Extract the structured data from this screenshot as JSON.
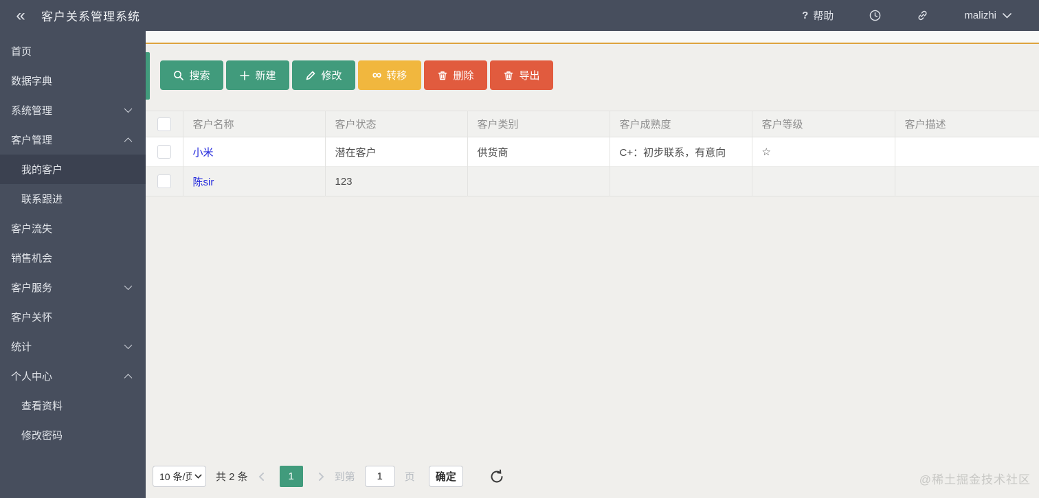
{
  "header": {
    "collapse_icon": "«",
    "title": "客户关系管理系统",
    "help_mark": "?",
    "help_label": "帮助",
    "username": "malizhi"
  },
  "sidebar": {
    "items": [
      {
        "label": "首页",
        "type": "top",
        "chevron": "none",
        "active": false
      },
      {
        "label": "数据字典",
        "type": "top",
        "chevron": "none",
        "active": false
      },
      {
        "label": "系统管理",
        "type": "top",
        "chevron": "down",
        "active": false
      },
      {
        "label": "客户管理",
        "type": "top",
        "chevron": "up",
        "active": false
      },
      {
        "label": "我的客户",
        "type": "sub",
        "chevron": "none",
        "active": true
      },
      {
        "label": "联系跟进",
        "type": "sub",
        "chevron": "none",
        "active": false
      },
      {
        "label": "客户流失",
        "type": "top",
        "chevron": "none",
        "active": false
      },
      {
        "label": "销售机会",
        "type": "top",
        "chevron": "none",
        "active": false
      },
      {
        "label": "客户服务",
        "type": "top",
        "chevron": "down",
        "active": false
      },
      {
        "label": "客户关怀",
        "type": "top",
        "chevron": "none",
        "active": false
      },
      {
        "label": "统计",
        "type": "top",
        "chevron": "down",
        "active": false
      },
      {
        "label": "个人中心",
        "type": "top",
        "chevron": "up",
        "active": false
      },
      {
        "label": "查看资料",
        "type": "sub",
        "chevron": "none",
        "active": false
      },
      {
        "label": "修改密码",
        "type": "sub",
        "chevron": "none",
        "active": false
      }
    ]
  },
  "toolbar": {
    "buttons": [
      {
        "label": "搜索",
        "icon": "search-icon",
        "color": "#419b7c"
      },
      {
        "label": "新建",
        "icon": "plus-icon",
        "color": "#419b7c"
      },
      {
        "label": "修改",
        "icon": "pencil-icon",
        "color": "#419b7c"
      },
      {
        "label": "转移",
        "icon": "transfer-icon",
        "color": "#f1b73e",
        "glyph": "∞"
      },
      {
        "label": "删除",
        "icon": "trash-icon",
        "color": "#e15b3e"
      },
      {
        "label": "导出",
        "icon": "trash-icon",
        "color": "#e15b3e"
      }
    ]
  },
  "table": {
    "columns": [
      "客户名称",
      "客户状态",
      "客户类别",
      "客户成熟度",
      "客户等级",
      "客户描述"
    ],
    "rows": [
      {
        "name": "小米",
        "status": "潜在客户",
        "category": "供货商",
        "maturity": "C+：初步联系，有意向",
        "level": "☆",
        "description": ""
      },
      {
        "name": "陈sir",
        "status": "123",
        "category": "",
        "maturity": "",
        "level": "",
        "description": ""
      }
    ]
  },
  "pagination": {
    "page_size": "10 条/页",
    "total": "共 2 条",
    "current_page": "1",
    "goto_prefix": "到第",
    "goto_value": "1",
    "goto_suffix": "页",
    "confirm_label": "确定"
  },
  "watermark": "@稀土掘金技术社区",
  "colors": {
    "header_dark": "#474e5d",
    "sidebar_active": "#3b4150",
    "accent_teal": "#419b7c",
    "accent_yellow": "#f1b73e",
    "accent_red": "#e15b3e",
    "accent_orange_line": "#dda33e",
    "link_blue": "#2228dc",
    "content_bg": "#f0efec"
  }
}
